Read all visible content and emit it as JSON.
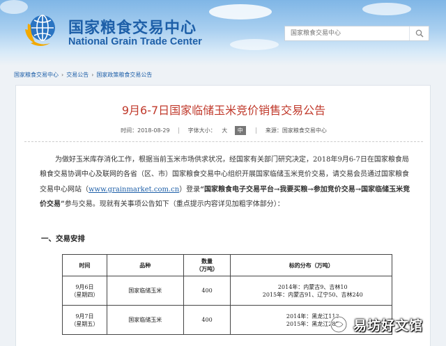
{
  "header": {
    "logo_cn": "国家粮食交易中心",
    "logo_en": "National Grain Trade Center",
    "search_placeholder": "国家粮食交易中心"
  },
  "breadcrumb": [
    "国家粮食交易中心",
    "交易公告",
    "国家政策粮食交易公告"
  ],
  "article": {
    "title": "9月6-7日国家临储玉米竞价销售交易公告",
    "meta": {
      "time_label": "时间：2018-08-29",
      "font_size_label": "字体大小：",
      "size_large": "大",
      "size_medium": "中",
      "source_label": "来源：国家粮食交易中心"
    },
    "para_1": "为做好玉米库存消化工作，根据当前玉米市场供求状况，经国家有关部门研究决定，2018年9月6-7日在国家粮食局粮食交易协调中心及联网的各省（区、市）国家粮食交易中心组织开展国家临储玉米竞价交易，请交易会员通过国家粮食交易中心网站（",
    "link": "www.grainmarket.com.cn",
    "para_2": "）登录",
    "bold_path": "“国家粮食电子交易平台→我要买粮→参加竞价交易→国家临储玉米竞价交易”",
    "para_3": "参与交易。现就有关事项公告如下（重点提示内容详见加粗字体部分）：",
    "section_1": "一、交易安排"
  },
  "table": {
    "headers": [
      "时间",
      "品种",
      "数量\n（万吨）",
      "标的分布（万吨）"
    ],
    "rows": [
      {
        "date": "9月6日",
        "weekday": "（星期四）",
        "variety": "国家临储玉米",
        "qty": "400",
        "dist_1": "2014年：内蒙古9、吉林10",
        "dist_2": "2015年：内蒙古91、辽宁50、吉林240"
      },
      {
        "date": "9月7日",
        "weekday": "（星期五）",
        "variety": "国家临储玉米",
        "qty": "400",
        "dist_1": "2014年：黑龙江113",
        "dist_2": "2015年：黑龙江287"
      }
    ]
  },
  "watermark": "易坊好文馆"
}
